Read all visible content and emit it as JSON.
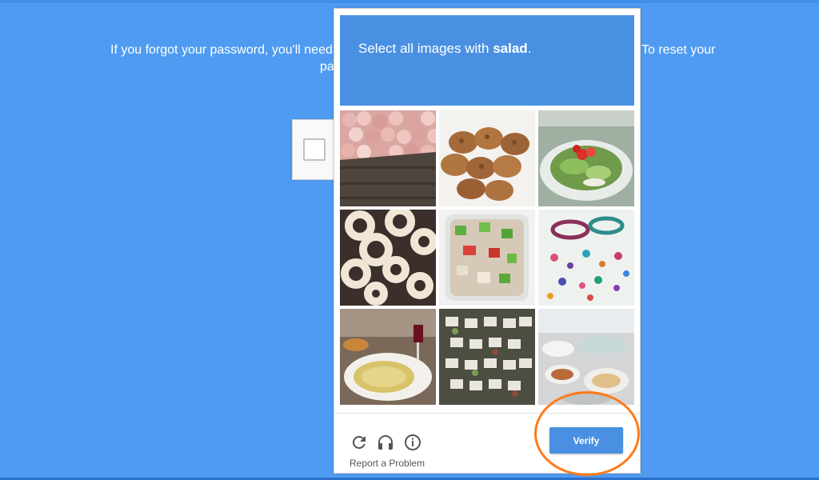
{
  "background": {
    "text_line1_left": "If you forgot your password, you'll need",
    "text_line1_right": "To reset your",
    "text_line2_left": "pa"
  },
  "captcha": {
    "prompt_prefix": "Select all images with",
    "prompt_keyword": "salad",
    "prompt_suffix": ".",
    "tiles": [
      {
        "label": "apples in crate"
      },
      {
        "label": "muffins"
      },
      {
        "label": "salad plate"
      },
      {
        "label": "onion rings"
      },
      {
        "label": "salad bowl"
      },
      {
        "label": "beads"
      },
      {
        "label": "dinner table"
      },
      {
        "label": "pastries"
      },
      {
        "label": "buffet"
      }
    ],
    "report_label": "Report a Problem",
    "verify_label": "Verify"
  },
  "colors": {
    "background": "#4f9bf2",
    "header": "#4a90e2",
    "verify": "#4a90e2",
    "annotation_ring": "#ff7a1a"
  }
}
